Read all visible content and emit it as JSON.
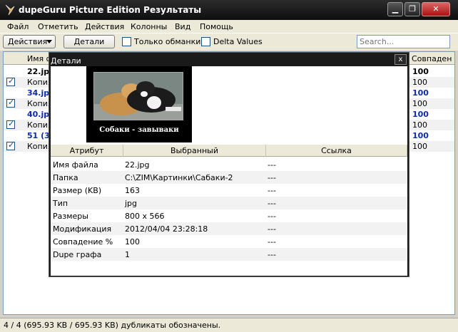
{
  "window": {
    "title": "dupeGuru Picture Edition Результаты",
    "min_label": "▁",
    "max_label": "❐",
    "close_label": "✕"
  },
  "menu": [
    "Файл",
    "Отметить",
    "Действия",
    "Колонны",
    "Вид",
    "Помощь"
  ],
  "toolbar": {
    "actions_label": "Действия",
    "details_label": "Детали",
    "only_dupes_label": "Только обманки",
    "delta_label": "Delta Values",
    "search_placeholder": "Search..."
  },
  "results": {
    "headers": [
      "Имя ф",
      "Совпаден"
    ],
    "rows": [
      {
        "name": "22.jp",
        "score": "100",
        "checked": false,
        "style": "bold"
      },
      {
        "name": "Копия",
        "score": "100",
        "checked": true,
        "style": "normal"
      },
      {
        "name": "34.jp",
        "score": "100",
        "checked": false,
        "style": "blue"
      },
      {
        "name": "Копия",
        "score": "100",
        "checked": true,
        "style": "normal"
      },
      {
        "name": "40.jp",
        "score": "100",
        "checked": false,
        "style": "blue"
      },
      {
        "name": "Копия",
        "score": "100",
        "checked": true,
        "style": "normal"
      },
      {
        "name": "51 (3",
        "score": "100",
        "checked": false,
        "style": "blue"
      },
      {
        "name": "Копия",
        "score": "100",
        "checked": true,
        "style": "normal"
      }
    ]
  },
  "details": {
    "title": "Детали",
    "close_label": "x",
    "preview_caption": "Собаки - завываки",
    "headers": [
      "Атрибут",
      "Выбранный",
      "Ссылка"
    ],
    "rows": [
      {
        "attr": "Имя файла",
        "selected": "22.jpg",
        "ref": "---"
      },
      {
        "attr": "Папка",
        "selected": "C:\\ZIM\\Картинки\\Сабаки-2",
        "ref": "---"
      },
      {
        "attr": "Размер (KB)",
        "selected": "163",
        "ref": "---"
      },
      {
        "attr": "Тип",
        "selected": "jpg",
        "ref": "---"
      },
      {
        "attr": "Размеры",
        "selected": "800 x 566",
        "ref": "---"
      },
      {
        "attr": "Модификация",
        "selected": "2012/04/04 23:28:18",
        "ref": "---"
      },
      {
        "attr": "Совпадение %",
        "selected": "100",
        "ref": "---"
      },
      {
        "attr": "Dupe графа",
        "selected": "1",
        "ref": "---"
      }
    ]
  },
  "status": {
    "text": "4 / 4 (695.93 KB / 695.93 KB) дубликаты обозначены."
  }
}
